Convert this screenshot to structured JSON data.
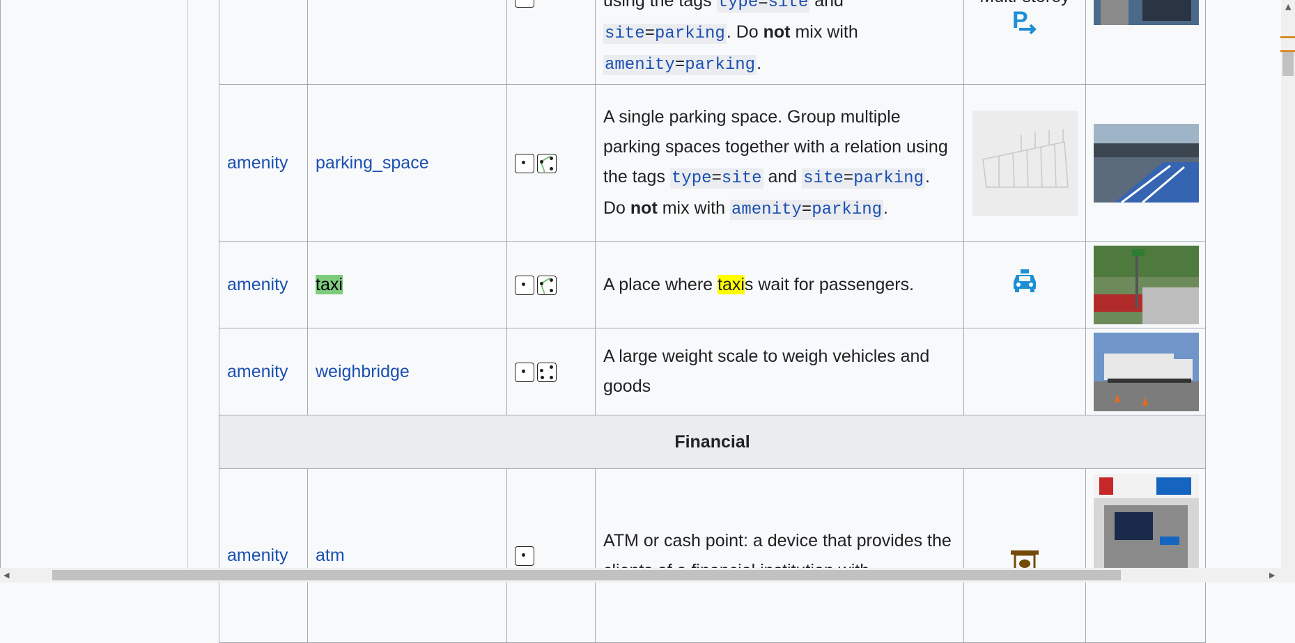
{
  "rows": {
    "prev": {
      "desc_line1_pre": "using the tags ",
      "desc_code1_k": "type",
      "desc_code1_v": "site",
      "desc_and": " and",
      "desc_code2_k": "site",
      "desc_code2_v": "parking",
      "desc_do": ". Do ",
      "desc_not": "not",
      "desc_mix": " mix with",
      "desc_code3_k": "amenity",
      "desc_code3_v": "parking",
      "desc_end": ".",
      "render_label": "Multi-storey"
    },
    "parking_space": {
      "key": "amenity",
      "value": "parking_space",
      "desc_pre": "A single parking space. Group multiple parking spaces together with a relation using the tags ",
      "desc_code1_k": "type",
      "desc_code1_v": "site",
      "desc_and": " and",
      "desc_code2_k": "site",
      "desc_code2_v": "parking",
      "desc_do": ". Do ",
      "desc_not": "not",
      "desc_mix": " mix with",
      "desc_code3_k": "amenity",
      "desc_code3_v": "parking",
      "desc_end": "."
    },
    "taxi": {
      "key": "amenity",
      "value": "taxi",
      "desc_pre": "A place where ",
      "desc_hl": "taxi",
      "desc_post": "s wait for passengers."
    },
    "weighbridge": {
      "key": "amenity",
      "value": "weighbridge",
      "desc": "A large weight scale to weigh vehicles and goods"
    },
    "section": {
      "title": "Financial"
    },
    "atm": {
      "key": "amenity",
      "value": "atm",
      "desc": "ATM or cash point: a device that provides the clients of a financial institution with"
    }
  },
  "equals": "=",
  "colors": {
    "link": "#1a4fb0",
    "taxi_highlight": "#7ecb7e",
    "search_highlight": "#ffff00",
    "taxi_icon": "#1e8fd6",
    "atm_icon": "#734a08"
  }
}
